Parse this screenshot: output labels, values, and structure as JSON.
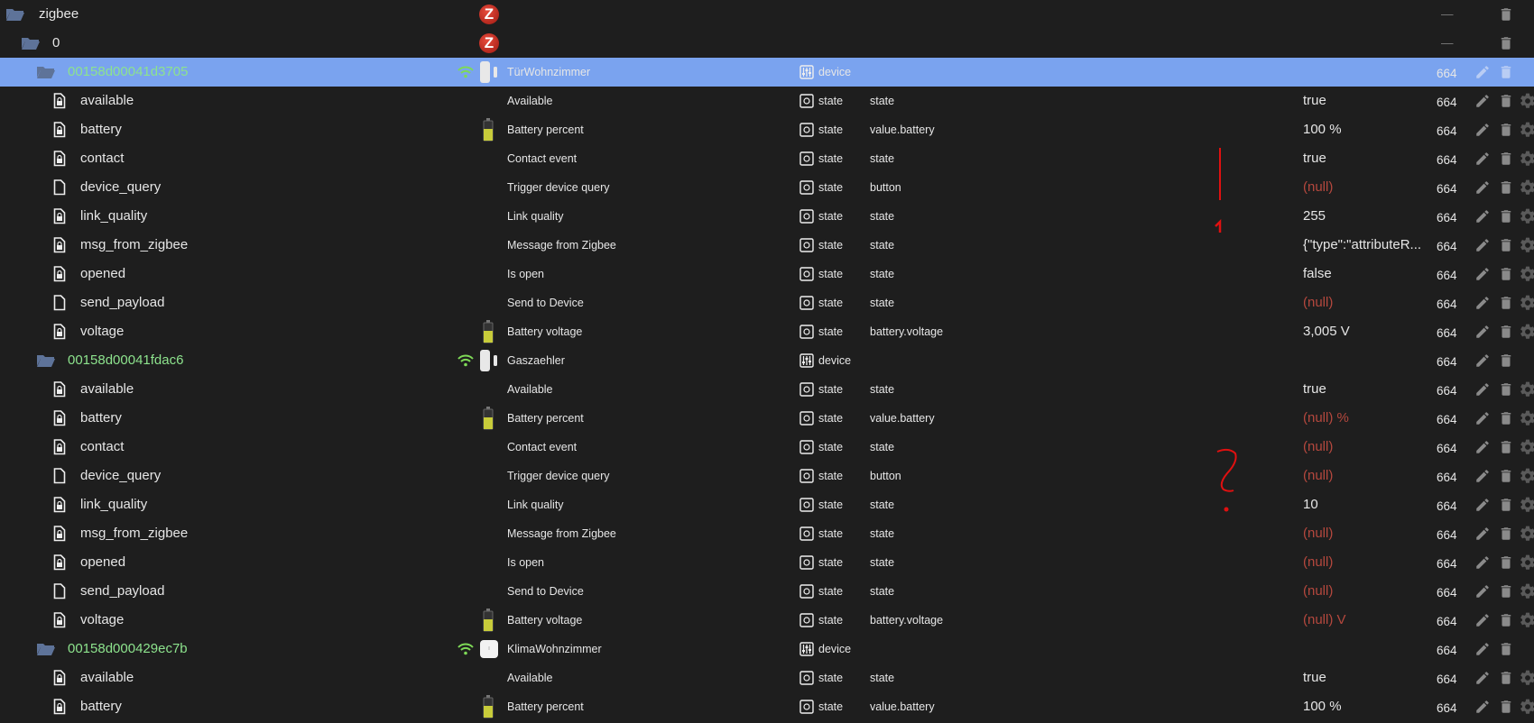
{
  "colors": {
    "background": "#1e1e1e",
    "selected_row": "#7aa3ef",
    "device_id": "#8de38d",
    "null_value": "#b5483e",
    "annotation": "#e01010",
    "wifi": "#7ed957"
  },
  "rows": [
    {
      "level": 0,
      "type": "folder",
      "id": "zigbee",
      "icon": "zigbee-logo-icon",
      "acl": "—",
      "actions": [
        "delete"
      ]
    },
    {
      "level": 1,
      "type": "folder",
      "id": "0",
      "icon": "zigbee-logo-icon",
      "acl": "—",
      "actions": [
        "delete"
      ]
    },
    {
      "level": 2,
      "type": "device",
      "id": "00158d00041d3705",
      "selected": true,
      "icon": "door-sensor-icon",
      "name": "TürWohnzimmer",
      "type_label": "device",
      "acl": "664",
      "actions": [
        "edit",
        "delete"
      ]
    },
    {
      "level": 3,
      "type": "state",
      "locked": true,
      "id": "available",
      "name": "Available",
      "type_label": "state",
      "role": "state",
      "value": "true",
      "acl": "664"
    },
    {
      "level": 3,
      "type": "state",
      "locked": true,
      "id": "battery",
      "icon": "battery-icon",
      "name": "Battery percent",
      "type_label": "state",
      "role": "value.battery",
      "value": "100 %",
      "acl": "664"
    },
    {
      "level": 3,
      "type": "state",
      "locked": true,
      "id": "contact",
      "name": "Contact event",
      "type_label": "state",
      "role": "state",
      "value": "true",
      "acl": "664"
    },
    {
      "level": 3,
      "type": "state",
      "locked": false,
      "id": "device_query",
      "name": "Trigger device query",
      "type_label": "state",
      "role": "button",
      "value": "(null)",
      "null": true,
      "acl": "664"
    },
    {
      "level": 3,
      "type": "state",
      "locked": true,
      "id": "link_quality",
      "name": "Link quality",
      "type_label": "state",
      "role": "state",
      "value": "255",
      "acl": "664"
    },
    {
      "level": 3,
      "type": "state",
      "locked": true,
      "id": "msg_from_zigbee",
      "name": "Message from Zigbee",
      "type_label": "state",
      "role": "state",
      "value": "{\"type\":\"attributeR...",
      "acl": "664"
    },
    {
      "level": 3,
      "type": "state",
      "locked": true,
      "id": "opened",
      "name": "Is open",
      "type_label": "state",
      "role": "state",
      "value": "false",
      "acl": "664"
    },
    {
      "level": 3,
      "type": "state",
      "locked": false,
      "id": "send_payload",
      "name": "Send to Device",
      "type_label": "state",
      "role": "state",
      "value": "(null)",
      "null": true,
      "acl": "664"
    },
    {
      "level": 3,
      "type": "state",
      "locked": true,
      "id": "voltage",
      "icon": "battery-icon",
      "name": "Battery voltage",
      "type_label": "state",
      "role": "battery.voltage",
      "value": "3,005 V",
      "acl": "664"
    },
    {
      "level": 2,
      "type": "device",
      "id": "00158d00041fdac6",
      "icon": "door-sensor-icon",
      "name": "Gaszaehler",
      "type_label": "device",
      "acl": "664",
      "actions": [
        "edit",
        "delete"
      ]
    },
    {
      "level": 3,
      "type": "state",
      "locked": true,
      "id": "available",
      "name": "Available",
      "type_label": "state",
      "role": "state",
      "value": "true",
      "acl": "664"
    },
    {
      "level": 3,
      "type": "state",
      "locked": true,
      "id": "battery",
      "icon": "battery-icon",
      "name": "Battery percent",
      "type_label": "state",
      "role": "value.battery",
      "value": "(null) %",
      "null": true,
      "acl": "664"
    },
    {
      "level": 3,
      "type": "state",
      "locked": true,
      "id": "contact",
      "name": "Contact event",
      "type_label": "state",
      "role": "state",
      "value": "(null)",
      "null": true,
      "acl": "664"
    },
    {
      "level": 3,
      "type": "state",
      "locked": false,
      "id": "device_query",
      "name": "Trigger device query",
      "type_label": "state",
      "role": "button",
      "value": "(null)",
      "null": true,
      "acl": "664"
    },
    {
      "level": 3,
      "type": "state",
      "locked": true,
      "id": "link_quality",
      "name": "Link quality",
      "type_label": "state",
      "role": "state",
      "value": "10",
      "acl": "664"
    },
    {
      "level": 3,
      "type": "state",
      "locked": true,
      "id": "msg_from_zigbee",
      "name": "Message from Zigbee",
      "type_label": "state",
      "role": "state",
      "value": "(null)",
      "null": true,
      "acl": "664"
    },
    {
      "level": 3,
      "type": "state",
      "locked": true,
      "id": "opened",
      "name": "Is open",
      "type_label": "state",
      "role": "state",
      "value": "(null)",
      "null": true,
      "acl": "664"
    },
    {
      "level": 3,
      "type": "state",
      "locked": false,
      "id": "send_payload",
      "name": "Send to Device",
      "type_label": "state",
      "role": "state",
      "value": "(null)",
      "null": true,
      "acl": "664"
    },
    {
      "level": 3,
      "type": "state",
      "locked": true,
      "id": "voltage",
      "icon": "battery-icon",
      "name": "Battery voltage",
      "type_label": "state",
      "role": "battery.voltage",
      "value": "(null) V",
      "null": true,
      "acl": "664"
    },
    {
      "level": 2,
      "type": "device",
      "id": "00158d000429ec7b",
      "icon": "climate-sensor-icon",
      "name": "KlimaWohnzimmer",
      "type_label": "device",
      "acl": "664",
      "actions": [
        "edit",
        "delete"
      ]
    },
    {
      "level": 3,
      "type": "state",
      "locked": true,
      "id": "available",
      "name": "Available",
      "type_label": "state",
      "role": "state",
      "value": "true",
      "acl": "664"
    },
    {
      "level": 3,
      "type": "state",
      "locked": true,
      "id": "battery",
      "icon": "battery-icon",
      "name": "Battery percent",
      "type_label": "state",
      "role": "value.battery",
      "value": "100 %",
      "acl": "664"
    }
  ],
  "annotations": {
    "mark_1": "1",
    "mark_2": "?"
  }
}
